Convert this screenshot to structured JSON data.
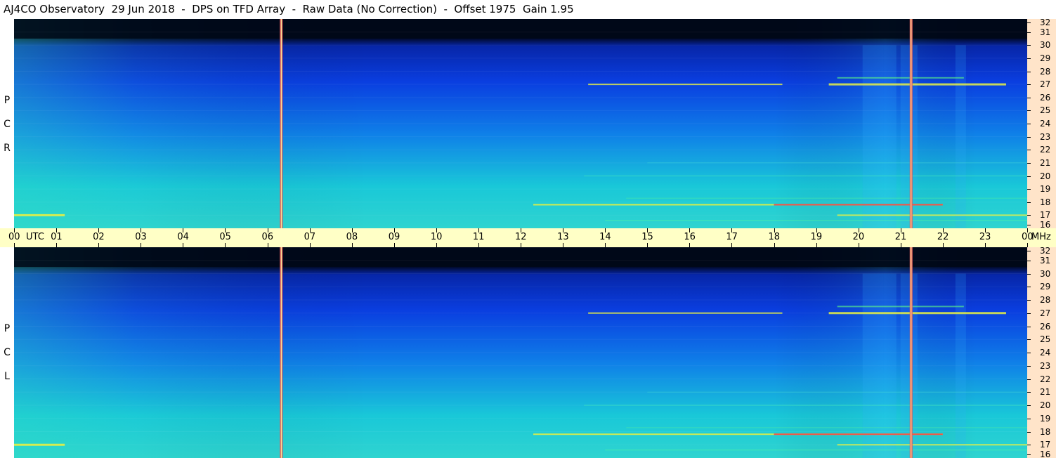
{
  "header": {
    "title": "AJ4CO Observatory  29 Jun 2018  -  DPS on TFD Array  -  Raw Data (No Correction)  -  Offset 1975  Gain 1.95"
  },
  "panels": [
    {
      "id": "rcp",
      "label_letters": [
        "P",
        "C",
        "R"
      ]
    },
    {
      "id": "lcp",
      "label_letters": [
        "P",
        "C",
        "L"
      ]
    }
  ],
  "time_axis": {
    "labels": [
      "00",
      "UTC",
      "01",
      "02",
      "03",
      "04",
      "05",
      "06",
      "07",
      "08",
      "09",
      "10",
      "11",
      "12",
      "13",
      "14",
      "15",
      "16",
      "17",
      "18",
      "19",
      "20",
      "21",
      "22",
      "23",
      "00",
      "MHz"
    ]
  },
  "freq_axis": {
    "labels": [
      "32",
      "31",
      "30",
      "29",
      "28",
      "27",
      "26",
      "25",
      "24",
      "23",
      "22",
      "21",
      "20",
      "19",
      "18",
      "17",
      "16"
    ]
  },
  "colors": {
    "background": "#ffffff",
    "time_axis_bg": "#ffffc6",
    "freq_axis_bg": "#ffe4c9",
    "spectrogram_low": "#000820",
    "spectrogram_mid": "#0a3ee0",
    "spectrogram_high": "#19c8d8",
    "interference_yellow": "#e6f040",
    "interference_red": "#ff4040",
    "marker_line": "#e06060"
  },
  "chart_data": [
    {
      "type": "heatmap",
      "title": "R C P",
      "x_range_utc_hours": [
        0,
        24
      ],
      "y_range_mhz": [
        16,
        32
      ],
      "x_tick_labels": [
        "00",
        "01",
        "02",
        "03",
        "04",
        "05",
        "06",
        "07",
        "08",
        "09",
        "10",
        "11",
        "12",
        "13",
        "14",
        "15",
        "16",
        "17",
        "18",
        "19",
        "20",
        "21",
        "22",
        "23",
        "00"
      ],
      "y_tick_labels": [
        "16",
        "17",
        "18",
        "19",
        "20",
        "21",
        "22",
        "23",
        "24",
        "25",
        "26",
        "27",
        "28",
        "29",
        "30",
        "31",
        "32"
      ],
      "marker_times_utc": [
        6.33,
        21.25
      ],
      "interference_bands_mhz": [
        17.0,
        17.8,
        27.0,
        27.5
      ]
    },
    {
      "type": "heatmap",
      "title": "L C P",
      "x_range_utc_hours": [
        0,
        24
      ],
      "y_range_mhz": [
        16,
        32
      ],
      "x_tick_labels": [
        "00",
        "01",
        "02",
        "03",
        "04",
        "05",
        "06",
        "07",
        "08",
        "09",
        "10",
        "11",
        "12",
        "13",
        "14",
        "15",
        "16",
        "17",
        "18",
        "19",
        "20",
        "21",
        "22",
        "23",
        "00"
      ],
      "y_tick_labels": [
        "16",
        "17",
        "18",
        "19",
        "20",
        "21",
        "22",
        "23",
        "24",
        "25",
        "26",
        "27",
        "28",
        "29",
        "30",
        "31",
        "32"
      ],
      "marker_times_utc": [
        6.33,
        21.25
      ],
      "interference_bands_mhz": [
        17.0,
        17.8,
        27.0,
        27.5
      ]
    }
  ]
}
